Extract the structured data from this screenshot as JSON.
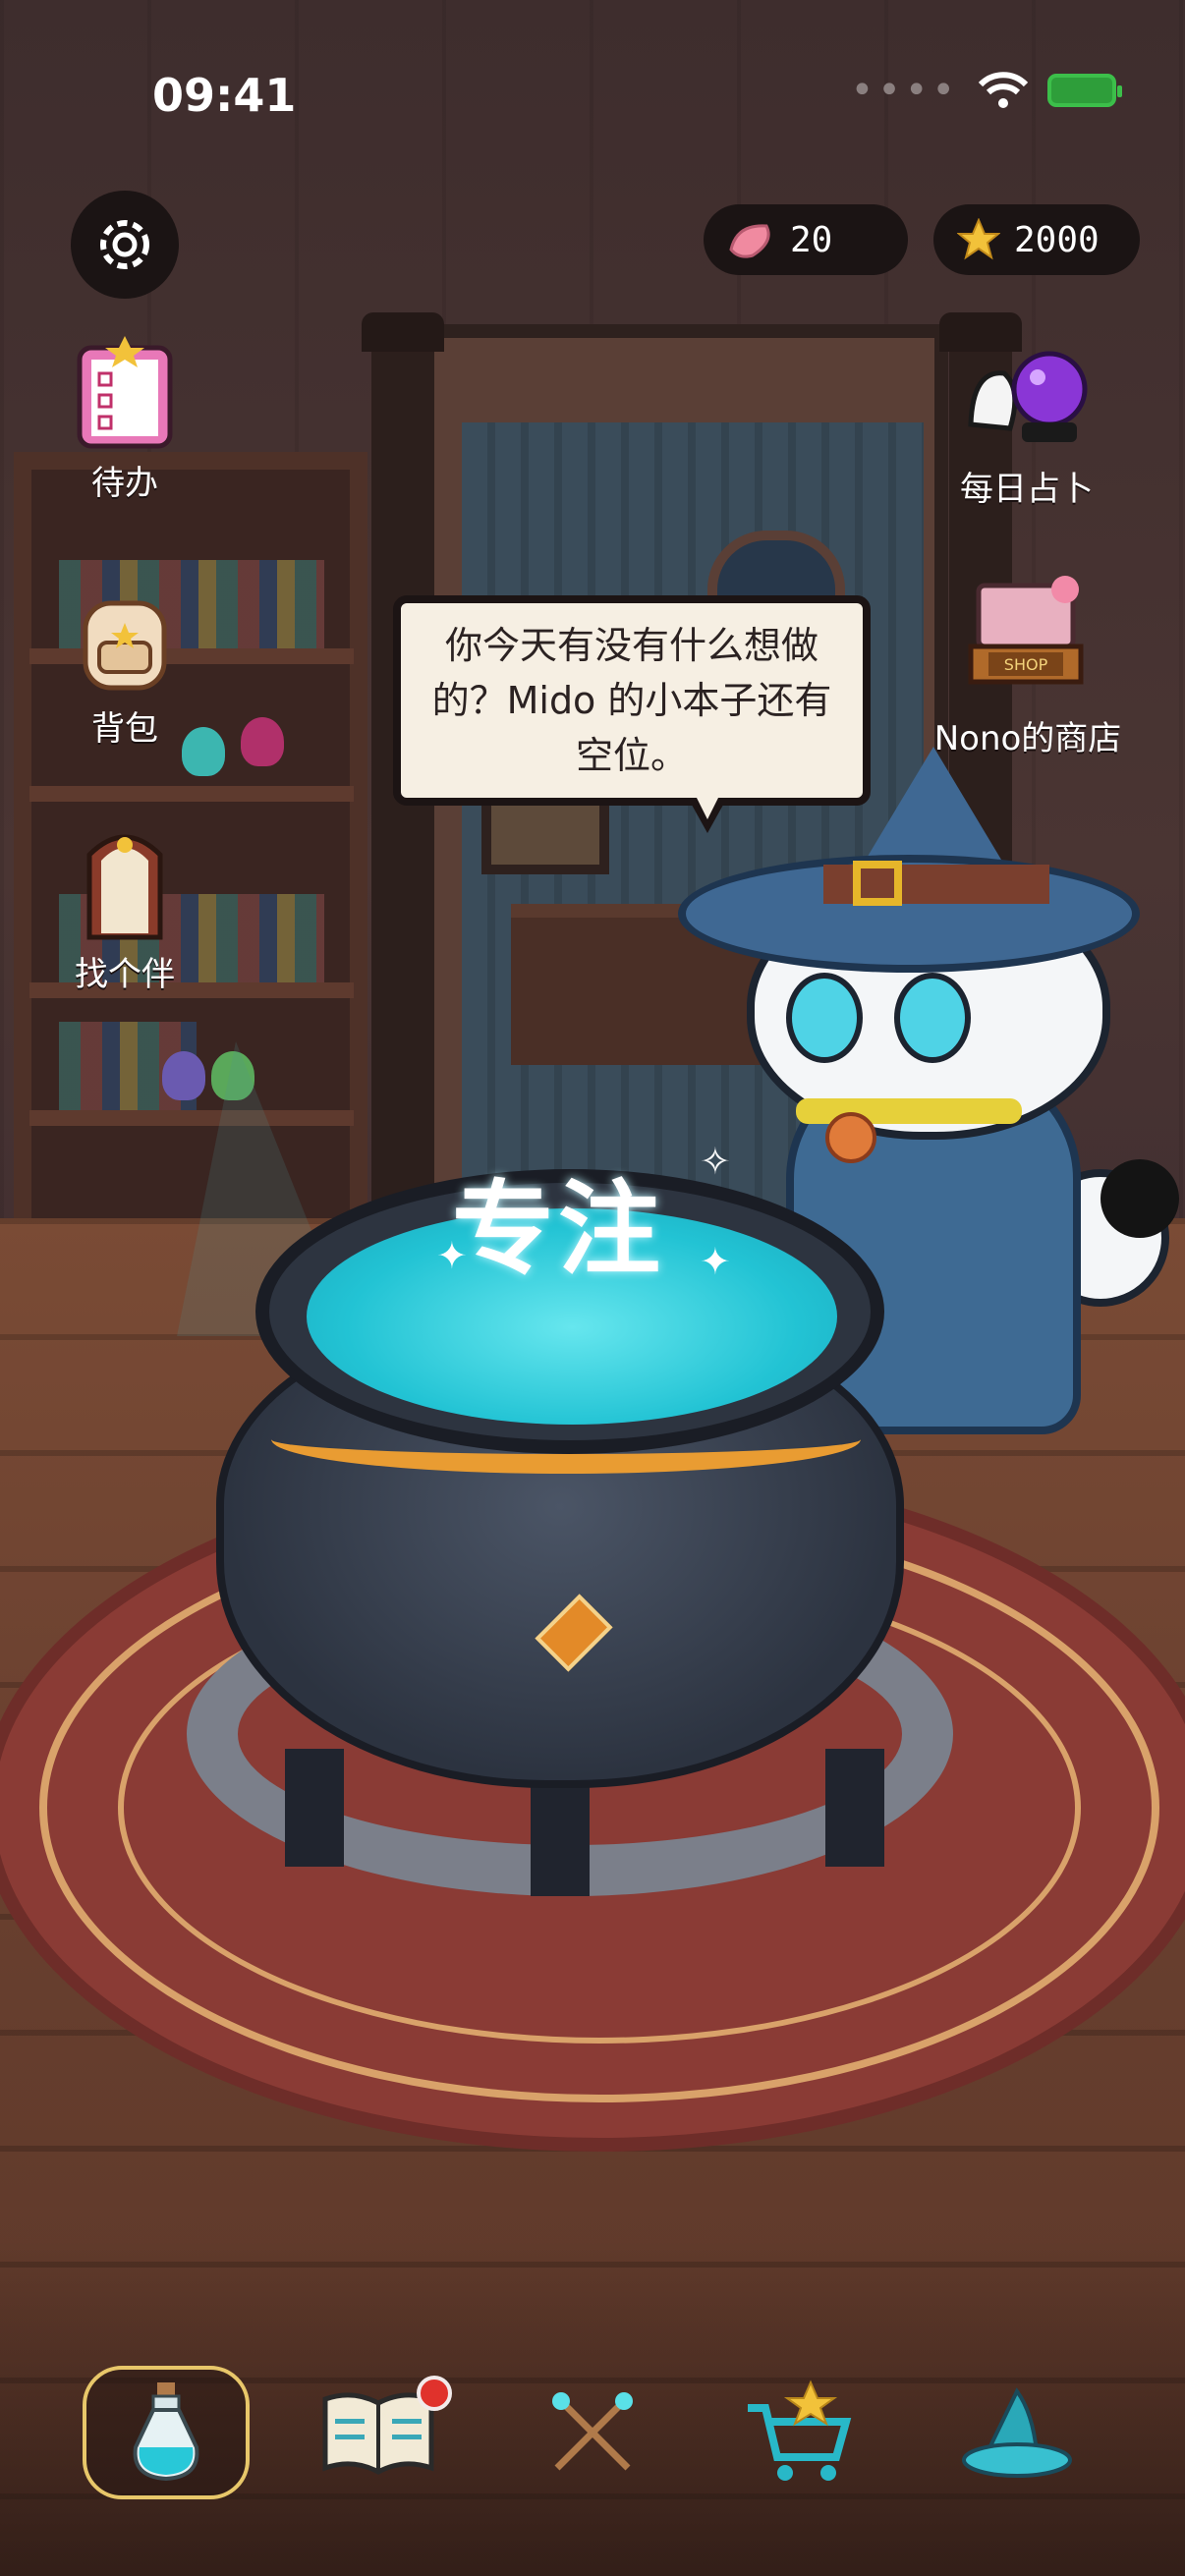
{
  "status_bar": {
    "time": "09:41"
  },
  "currency": {
    "petals": "20",
    "stars": "2000"
  },
  "left_menu": [
    {
      "label": "待办",
      "icon": "todo-clipboard-icon"
    },
    {
      "label": "背包",
      "icon": "backpack-icon"
    },
    {
      "label": "找个伴",
      "icon": "companion-door-icon"
    }
  ],
  "right_menu": [
    {
      "label": "每日占卜",
      "icon": "crystal-ball-icon"
    },
    {
      "label": "Nono的商店",
      "icon": "shop-icon"
    }
  ],
  "speech_bubble": {
    "text": "你今天有没有什么想做的？Mido 的小本子还有空位。"
  },
  "cauldron": {
    "label": "专注"
  },
  "bottom_nav": [
    {
      "icon": "potion-icon",
      "active": true
    },
    {
      "icon": "book-icon",
      "has_badge": true
    },
    {
      "icon": "wands-icon"
    },
    {
      "icon": "shop-cart-icon"
    },
    {
      "icon": "wizard-hat-icon"
    }
  ],
  "colors": {
    "accent": "#e8c76a",
    "liquid": "#22c3d4",
    "badge": "#e0322c"
  }
}
